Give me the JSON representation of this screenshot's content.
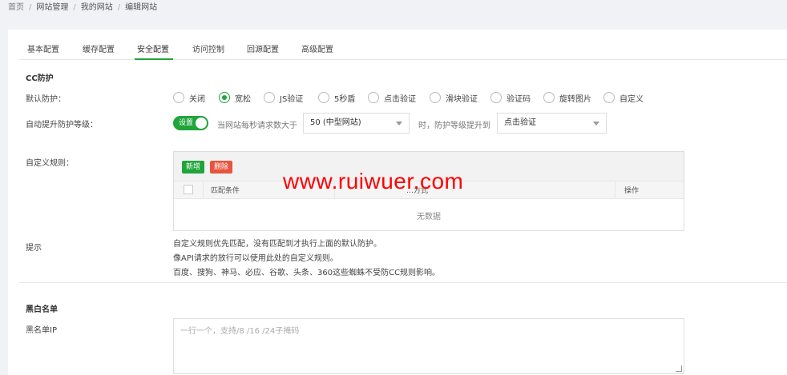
{
  "breadcrumb": [
    "首页",
    "网站管理",
    "我的网站",
    "编辑网站"
  ],
  "tabs": [
    {
      "label": "基本配置",
      "active": false
    },
    {
      "label": "缓存配置",
      "active": false
    },
    {
      "label": "安全配置",
      "active": true
    },
    {
      "label": "访问控制",
      "active": false
    },
    {
      "label": "回源配置",
      "active": false
    },
    {
      "label": "高级配置",
      "active": false
    }
  ],
  "cc": {
    "title": "CC防护",
    "default_label": "默认防护：",
    "options": [
      "关闭",
      "宽松",
      "JS验证",
      "5秒盾",
      "点击验证",
      "滑块验证",
      "验证码",
      "旋转图片",
      "自定义"
    ],
    "selected": "宽松",
    "auto_label": "自动提升防护等级：",
    "toggle_text": "设置",
    "auto_prefix": "当网站每秒请求数大于",
    "rps_select": "50 (中型网站)",
    "auto_middle": "时，防护等级提升到",
    "level_select": "点击验证",
    "rules_label": "自定义规则：",
    "add_button": "新增",
    "delete_button": "删除",
    "col_match": "匹配条件",
    "col_action_obscured": "…方式",
    "col_ops": "操作",
    "empty_text": "无数据",
    "tips_label": "提示",
    "tips": [
      "自定义规则优先匹配，没有匹配到才执行上面的默认防护。",
      "像API请求的放行可以使用此处的自定义规则。",
      "百度、搜狗、神马、必应、谷歌、头条、360这些蜘蛛不受防CC规则影响。"
    ]
  },
  "blackwhite": {
    "title": "黑白名单",
    "black_label": "黑名单IP",
    "black_placeholder": "一行一个，支持/8 /16 /24子掩码"
  },
  "watermark": "www.ruiwuer.com",
  "colors": {
    "accent": "#20a53a",
    "danger": "#e8543e",
    "watermark": "#ff0000"
  }
}
